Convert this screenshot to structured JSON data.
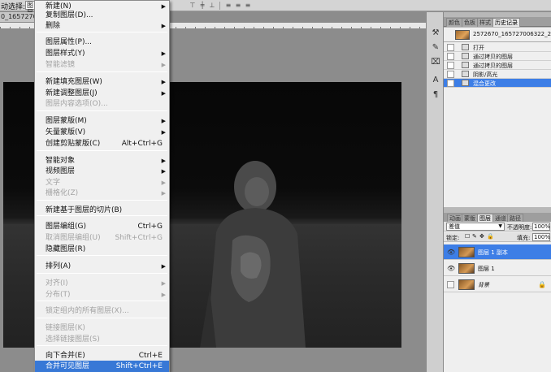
{
  "options_bar": {
    "label": "动选择:",
    "select_value": "图层"
  },
  "document": {
    "tab_label": "0_1657270063"
  },
  "menu": {
    "items": [
      {
        "label": "新建(N)",
        "shortcut": "",
        "submenu": true,
        "disabled": false,
        "highlighted": false
      },
      {
        "label": "复制图层(D)...",
        "shortcut": "",
        "submenu": false,
        "disabled": false,
        "highlighted": false
      },
      {
        "label": "删除",
        "shortcut": "",
        "submenu": true,
        "disabled": false,
        "highlighted": false
      },
      {
        "label": "图层属性(P)...",
        "shortcut": "",
        "submenu": false,
        "disabled": false,
        "highlighted": false
      },
      {
        "label": "图层样式(Y)",
        "shortcut": "",
        "submenu": true,
        "disabled": false,
        "highlighted": false
      },
      {
        "label": "智能滤镜",
        "shortcut": "",
        "submenu": true,
        "disabled": true,
        "highlighted": false
      },
      {
        "label": "新建填充图层(W)",
        "shortcut": "",
        "submenu": true,
        "disabled": false,
        "highlighted": false
      },
      {
        "label": "新建调整图层(J)",
        "shortcut": "",
        "submenu": true,
        "disabled": false,
        "highlighted": false
      },
      {
        "label": "图层内容选项(O)...",
        "shortcut": "",
        "submenu": false,
        "disabled": true,
        "highlighted": false
      },
      {
        "label": "图层蒙版(M)",
        "shortcut": "",
        "submenu": true,
        "disabled": false,
        "highlighted": false
      },
      {
        "label": "矢量蒙版(V)",
        "shortcut": "",
        "submenu": true,
        "disabled": false,
        "highlighted": false
      },
      {
        "label": "创建剪贴蒙版(C)",
        "shortcut": "Alt+Ctrl+G",
        "submenu": false,
        "disabled": false,
        "highlighted": false
      },
      {
        "label": "智能对象",
        "shortcut": "",
        "submenu": true,
        "disabled": false,
        "highlighted": false
      },
      {
        "label": "视频图层",
        "shortcut": "",
        "submenu": true,
        "disabled": false,
        "highlighted": false
      },
      {
        "label": "文字",
        "shortcut": "",
        "submenu": true,
        "disabled": true,
        "highlighted": false
      },
      {
        "label": "栅格化(Z)",
        "shortcut": "",
        "submenu": true,
        "disabled": true,
        "highlighted": false
      },
      {
        "label": "新建基于图层的切片(B)",
        "shortcut": "",
        "submenu": false,
        "disabled": false,
        "highlighted": false
      },
      {
        "label": "图层编组(G)",
        "shortcut": "Ctrl+G",
        "submenu": false,
        "disabled": false,
        "highlighted": false
      },
      {
        "label": "取消图层编组(U)",
        "shortcut": "Shift+Ctrl+G",
        "submenu": false,
        "disabled": true,
        "highlighted": false
      },
      {
        "label": "隐藏图层(R)",
        "shortcut": "",
        "submenu": false,
        "disabled": false,
        "highlighted": false
      },
      {
        "label": "排列(A)",
        "shortcut": "",
        "submenu": true,
        "disabled": false,
        "highlighted": false
      },
      {
        "label": "对齐(I)",
        "shortcut": "",
        "submenu": true,
        "disabled": true,
        "highlighted": false
      },
      {
        "label": "分布(T)",
        "shortcut": "",
        "submenu": true,
        "disabled": true,
        "highlighted": false
      },
      {
        "label": "锁定组内的所有图层(X)...",
        "shortcut": "",
        "submenu": false,
        "disabled": true,
        "highlighted": false
      },
      {
        "label": "链接图层(K)",
        "shortcut": "",
        "submenu": false,
        "disabled": true,
        "highlighted": false
      },
      {
        "label": "选择链接图层(S)",
        "shortcut": "",
        "submenu": false,
        "disabled": true,
        "highlighted": false
      },
      {
        "label": "向下合并(E)",
        "shortcut": "Ctrl+E",
        "submenu": false,
        "disabled": false,
        "highlighted": false
      },
      {
        "label": "合并可见图层",
        "shortcut": "Shift+Ctrl+E",
        "submenu": false,
        "disabled": false,
        "highlighted": true
      }
    ]
  },
  "history_panel": {
    "tabs": [
      {
        "label": "颜色",
        "active": false
      },
      {
        "label": "色板",
        "active": false
      },
      {
        "label": "样式",
        "active": false
      },
      {
        "label": "历史记录",
        "active": true
      }
    ],
    "snapshot": "2572670_165727006322_2.jpg",
    "states": [
      {
        "label": "打开",
        "selected": false
      },
      {
        "label": "通过拷贝的图层",
        "selected": false
      },
      {
        "label": "通过拷贝的图层",
        "selected": false
      },
      {
        "label": "阴影/高光",
        "selected": false
      },
      {
        "label": "混合更改",
        "selected": true
      }
    ]
  },
  "layers_panel": {
    "tabs": [
      {
        "label": "动画",
        "active": false
      },
      {
        "label": "蒙版",
        "active": false
      },
      {
        "label": "图层",
        "active": true
      },
      {
        "label": "通道",
        "active": false
      },
      {
        "label": "路径",
        "active": false
      }
    ],
    "blend_mode": "差值",
    "opacity_label": "不透明度:",
    "opacity_value": "100%",
    "lock_label": "锁定:",
    "fill_label": "填充:",
    "fill_value": "100%",
    "layers": [
      {
        "name": "图层 1 副本",
        "selected": true,
        "visible": true,
        "locked": false
      },
      {
        "name": "图层 1",
        "selected": false,
        "visible": true,
        "locked": false
      },
      {
        "name": "背景",
        "selected": false,
        "visible": false,
        "locked": true
      }
    ]
  }
}
